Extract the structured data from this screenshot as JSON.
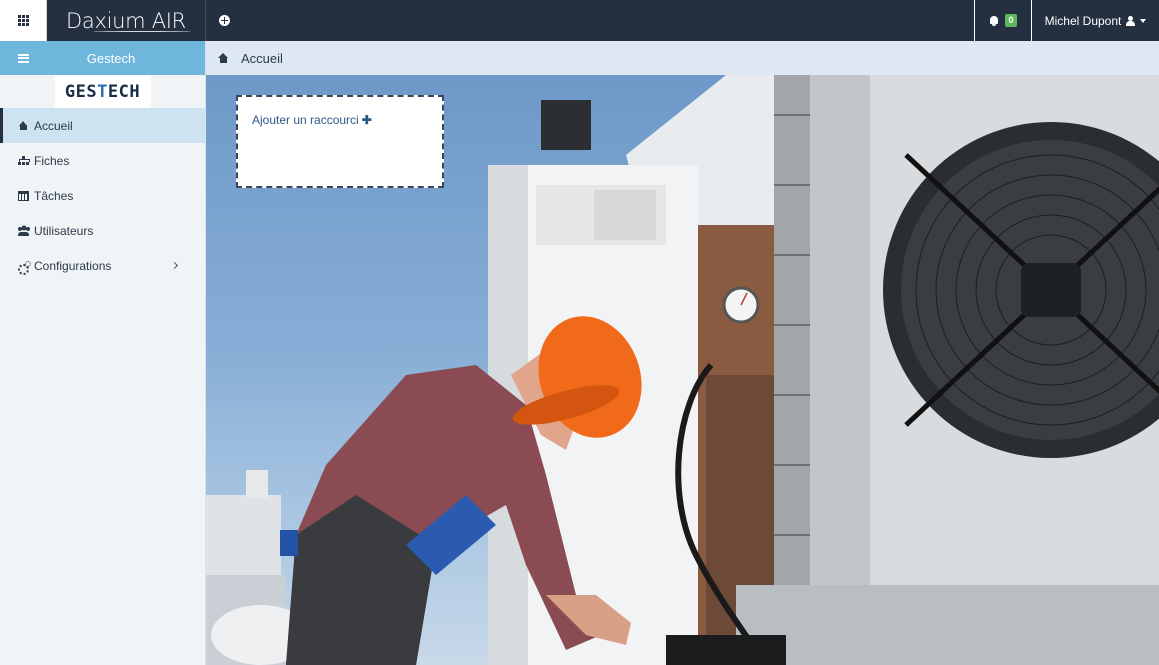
{
  "topbar": {
    "brand": "Daxium AIR",
    "notifications_count": "0",
    "user_name": "Michel Dupont"
  },
  "sidebar": {
    "title": "Gestech",
    "logo_text_a": "GES",
    "logo_text_b": "T",
    "logo_text_c": "ECH",
    "items": [
      {
        "label": "Accueil",
        "icon": "home-icon",
        "active": true
      },
      {
        "label": "Fiches",
        "icon": "sitemap-icon",
        "active": false
      },
      {
        "label": "Tâches",
        "icon": "calendar-icon",
        "active": false
      },
      {
        "label": "Utilisateurs",
        "icon": "users-icon",
        "active": false
      },
      {
        "label": "Configurations",
        "icon": "cogs-icon",
        "active": false
      }
    ]
  },
  "breadcrumb": {
    "label": "Accueil"
  },
  "main": {
    "shortcut_label": "Ajouter un raccourci",
    "shortcut_plus": "✚"
  },
  "colors": {
    "topbar_bg": "#243040",
    "sidebar_header": "#6fb6dd",
    "active_item": "#cde3f1",
    "badge": "#5cb85c"
  }
}
